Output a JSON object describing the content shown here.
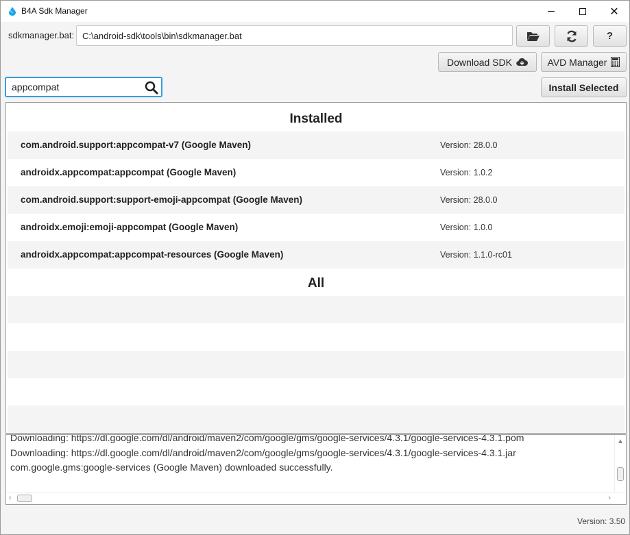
{
  "window": {
    "title": "B4A Sdk Manager",
    "controls": {
      "minimize": "—",
      "maximize": "☐",
      "close": "✕"
    }
  },
  "toolbar": {
    "path_label": "sdkmanager.bat:",
    "path_value": "C:\\android-sdk\\tools\\bin\\sdkmanager.bat",
    "help_label": "?",
    "download_sdk_label": "Download SDK",
    "avd_manager_label": "AVD Manager",
    "install_selected_label": "Install Selected"
  },
  "search": {
    "value": "appcompat",
    "placeholder": ""
  },
  "list": {
    "installed_header": "Installed",
    "all_header": "All",
    "installed": [
      {
        "name": "com.android.support:appcompat-v7 (Google Maven)",
        "version": "Version: 28.0.0"
      },
      {
        "name": "androidx.appcompat:appcompat (Google Maven)",
        "version": "Version: 1.0.2"
      },
      {
        "name": "com.android.support:support-emoji-appcompat (Google Maven)",
        "version": "Version: 28.0.0"
      },
      {
        "name": "androidx.emoji:emoji-appcompat (Google Maven)",
        "version": "Version: 1.0.0"
      },
      {
        "name": "androidx.appcompat:appcompat-resources (Google Maven)",
        "version": "Version: 1.1.0-rc01"
      }
    ]
  },
  "log": {
    "lines": [
      "Downloading: https://dl.google.com/dl/android/maven2/com/google/gms/google-services/4.3.1/google-services-4.3.1.pom",
      "Downloading: https://dl.google.com/dl/android/maven2/com/google/gms/google-services/4.3.1/google-services-4.3.1.jar",
      "com.google.gms:google-services (Google Maven) downloaded successfully."
    ]
  },
  "footer": {
    "version": "Version: 3.50"
  },
  "colors": {
    "accent": "#3a9bdc",
    "row_alt": "#f4f4f4",
    "icon_brand": "#1aa3e8"
  },
  "icons": {
    "app": "b4a-droplet-icon",
    "folder": "folder-open-icon",
    "refresh": "refresh-icon",
    "search": "search-icon",
    "download": "cloud-download-icon",
    "avd": "calculator-icon"
  }
}
